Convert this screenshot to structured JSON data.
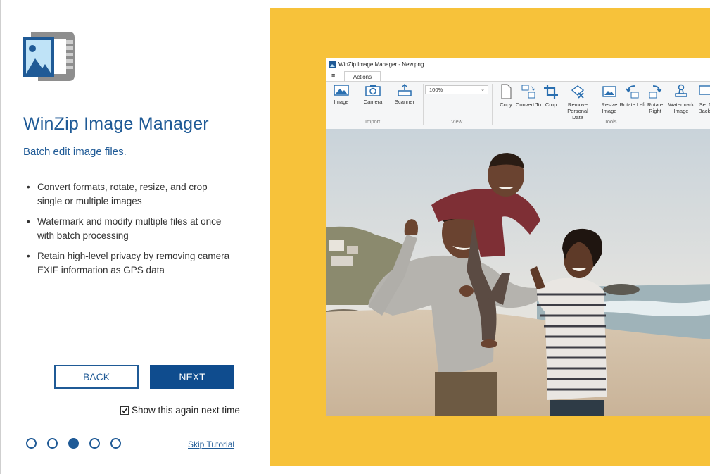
{
  "app": {
    "title": "WinZip Image Manager",
    "subtitle": "Batch edit image files."
  },
  "features": [
    "Convert formats, rotate, resize, and crop single or multiple images",
    "Watermark and modify multiple files at once with batch processing",
    "Retain high-level privacy by removing camera EXIF information as GPS data"
  ],
  "buttons": {
    "back": "BACK",
    "next": "NEXT"
  },
  "show_again": {
    "label": "Show this again next time",
    "checked": true
  },
  "pagination": {
    "total": 5,
    "current": 3
  },
  "skip_label": "Skip Tutorial",
  "screenshot": {
    "window_title": "WinZip Image Manager - New.png",
    "menu_glyph": "≡",
    "tab": "Actions",
    "import": {
      "label": "Import",
      "items": [
        "Image",
        "Camera",
        "Scanner"
      ]
    },
    "view": {
      "label": "View",
      "zoom": "100%"
    },
    "tools": {
      "label": "Tools",
      "items": [
        "Copy",
        "Convert To",
        "Crop",
        "Remove Personal Data",
        "Resize Image",
        "Rotate Left",
        "Rotate Right",
        "Watermark Image",
        "Set D Backg"
      ]
    }
  },
  "colors": {
    "brand_blue": "#1f5a96",
    "next_button": "#0f4c8e",
    "panel_yellow": "#f7c23a"
  }
}
